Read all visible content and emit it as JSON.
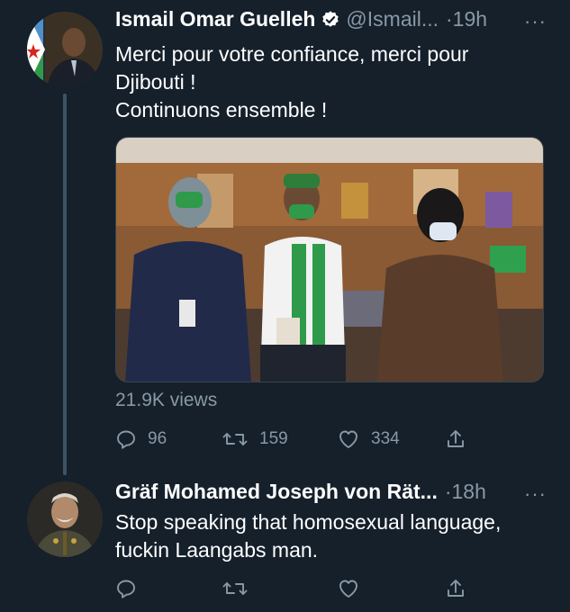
{
  "tweets": [
    {
      "name": "Ismail Omar Guelleh",
      "handle": "@Ismail...",
      "time": "·19h",
      "more": "···",
      "lines": [
        "Merci pour votre confiance, merci pour",
        "Djibouti !",
        "Continuons ensemble !"
      ],
      "views": "21.9K views",
      "replies": "96",
      "retweets": "159",
      "likes": "334"
    },
    {
      "name": "Gräf Mohamed Joseph von Rät...",
      "time": "·18h",
      "more": "···",
      "lines": [
        "Stop speaking that homosexual language,",
        "fuckin Laangabs man."
      ]
    }
  ],
  "colors": {
    "background": "#15202b",
    "text_primary": "#ffffff",
    "text_secondary": "#8899a6",
    "verified_badge": "#ffffff",
    "flag_green": "#6ab2e7",
    "sash_green": "#2e9a4a"
  },
  "icons": [
    "verified-icon",
    "reply-icon",
    "retweet-icon",
    "like-icon",
    "share-icon",
    "more-icon"
  ]
}
